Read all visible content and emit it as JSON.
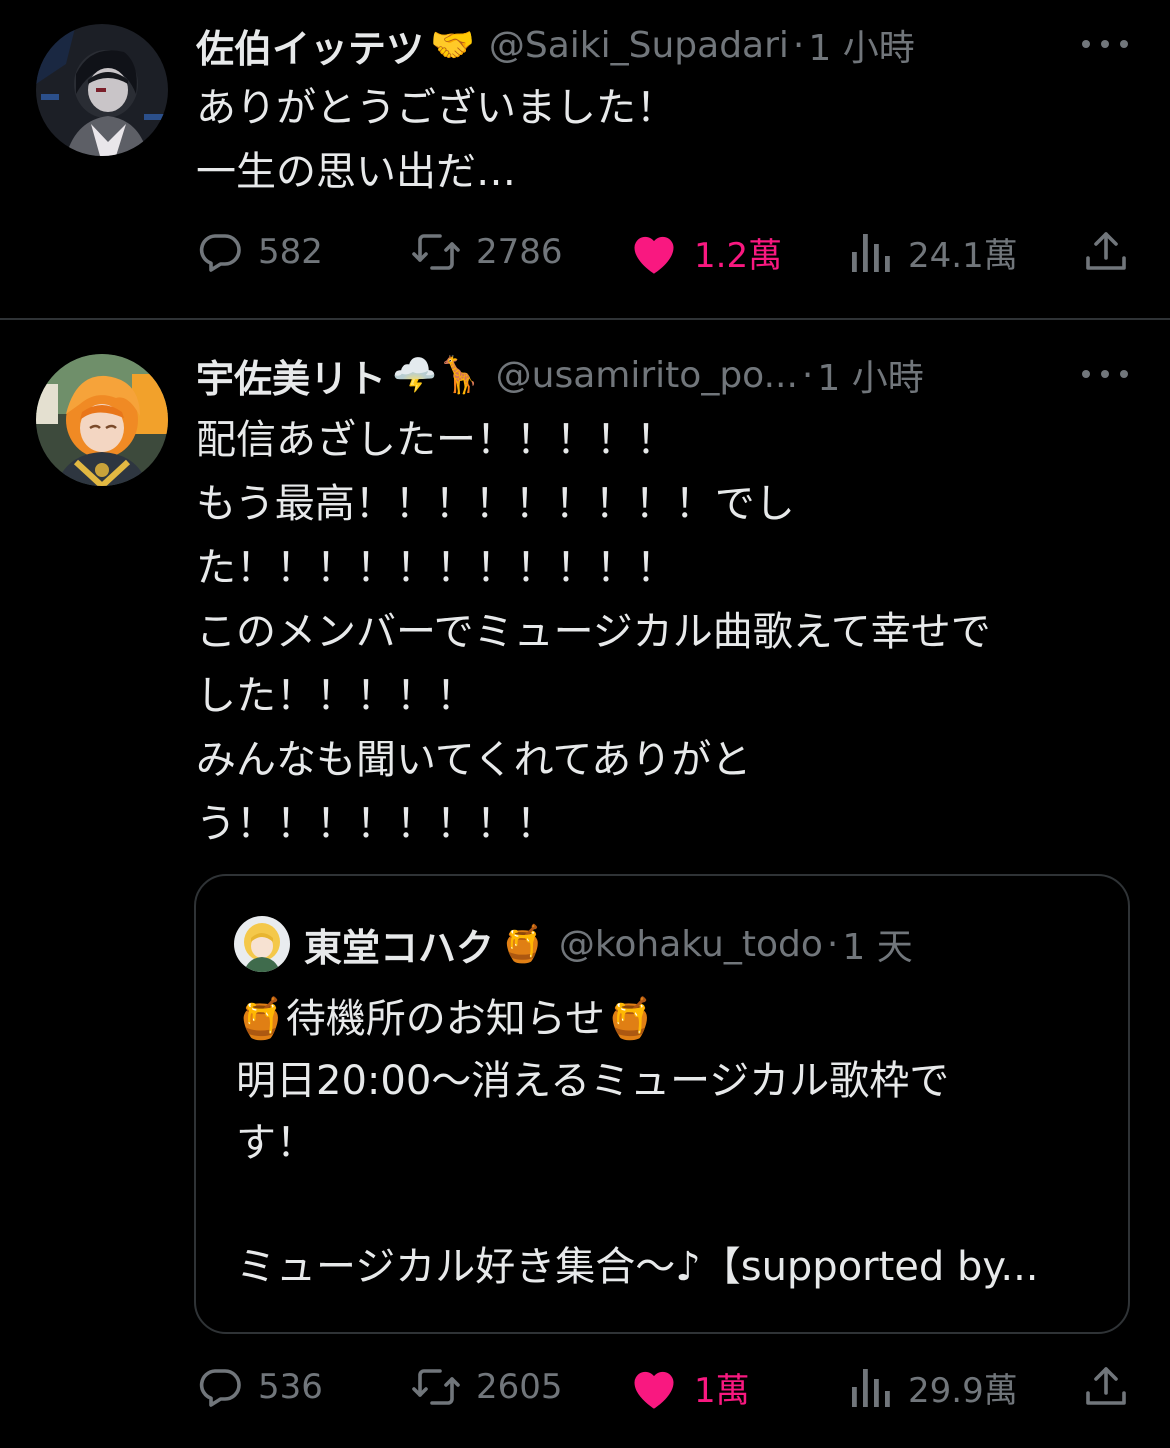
{
  "tweets": [
    {
      "name": "佐伯イッテツ",
      "name_emoji": "🤝",
      "handle": "@Saiki_Supadari",
      "separator": "·",
      "time": "1 小時",
      "body_lines": [
        "ありがとうございました！",
        "一生の思い出だ…"
      ],
      "actions": {
        "replies": "582",
        "retweets": "2786",
        "likes": "1.2萬",
        "views": "24.1萬"
      }
    },
    {
      "name": "宇佐美リト",
      "name_emoji": "🌩️🦒",
      "handle": "@usamirito_po...",
      "separator": "·",
      "time": "1 小時",
      "body_lines": [
        "配信あざしたー！！！！！",
        "もう最高！！！！！！！！！でし",
        "た！！！！！！！！！！！",
        "このメンバーでミュージカル曲歌えて幸せで",
        "した！！！！！",
        "みんなも聞いてくれてありがと",
        "う！！！！！！！！"
      ],
      "quote": {
        "name": "東堂コハク",
        "name_emoji": "🍯",
        "handle": "@kohaku_todo",
        "separator": "·",
        "time": "1 天",
        "body_lines": [
          "🍯待機所のお知らせ🍯",
          "明日20:00～消えるミュージカル歌枠で",
          "す！",
          "",
          "ミュージカル好き集合～♪【supported by..."
        ]
      },
      "actions": {
        "replies": "536",
        "retweets": "2605",
        "likes": "1萬",
        "views": "29.9萬"
      }
    }
  ],
  "icons": {
    "reply": "reply-icon",
    "retweet": "retweet-icon",
    "like": "heart-icon",
    "views": "views-icon",
    "share": "share-icon",
    "more": "more-icon"
  },
  "colors": {
    "background": "#000000",
    "text": "#e7e9ea",
    "muted": "#71767b",
    "like": "#f91880",
    "border": "#2f3336"
  }
}
